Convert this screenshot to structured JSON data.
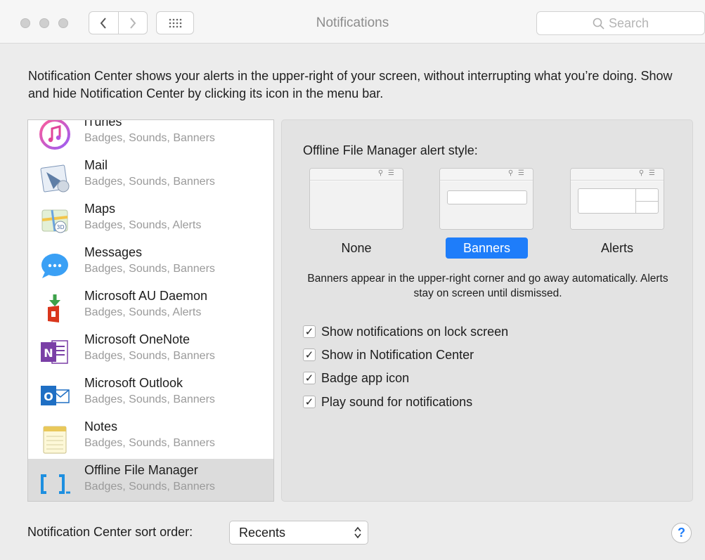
{
  "window": {
    "title": "Notifications",
    "search_placeholder": "Search",
    "back_glyph": "<",
    "forward_glyph": ">",
    "grid_glyph": "∷"
  },
  "description": "Notification Center shows your alerts in the upper-right of your screen, without interrupting what you’re doing. Show and hide Notification Center by clicking its icon in the menu bar.",
  "apps": [
    {
      "name": "iTunes",
      "sub": "Badges, Sounds, Banners",
      "icon": "itunes-icon"
    },
    {
      "name": "Mail",
      "sub": "Badges, Sounds, Banners",
      "icon": "mail-icon"
    },
    {
      "name": "Maps",
      "sub": "Badges, Sounds, Alerts",
      "icon": "maps-icon"
    },
    {
      "name": "Messages",
      "sub": "Badges, Sounds, Banners",
      "icon": "messages-icon"
    },
    {
      "name": "Microsoft AU Daemon",
      "sub": "Badges, Sounds, Alerts",
      "icon": "microsoft-au-daemon-icon"
    },
    {
      "name": "Microsoft OneNote",
      "sub": "Badges, Sounds, Banners",
      "icon": "onenote-icon"
    },
    {
      "name": "Microsoft Outlook",
      "sub": "Badges, Sounds, Banners",
      "icon": "outlook-icon"
    },
    {
      "name": "Notes",
      "sub": "Badges, Sounds, Banners",
      "icon": "notes-icon"
    },
    {
      "name": "Offline File Manager",
      "sub": "Badges, Sounds, Banners",
      "icon": "offline-file-manager-icon",
      "selected": true
    }
  ],
  "panel": {
    "title": "Offline File Manager alert style:",
    "styles": [
      {
        "label": "None",
        "selected": false
      },
      {
        "label": "Banners",
        "selected": true
      },
      {
        "label": "Alerts",
        "selected": false
      }
    ],
    "help_text": "Banners appear in the upper-right corner and go away automatically. Alerts stay on screen until dismissed.",
    "checkboxes": [
      {
        "label": "Show notifications on lock screen",
        "checked": true
      },
      {
        "label": "Show in Notification Center",
        "checked": true
      },
      {
        "label": "Badge app icon",
        "checked": true
      },
      {
        "label": "Play sound for notifications",
        "checked": true
      }
    ]
  },
  "footer": {
    "sort_label": "Notification Center sort order:",
    "sort_value": "Recents",
    "help_label": "?"
  },
  "colors": {
    "accent": "#1e7dfa",
    "selected_row": "#dcdcdc"
  }
}
